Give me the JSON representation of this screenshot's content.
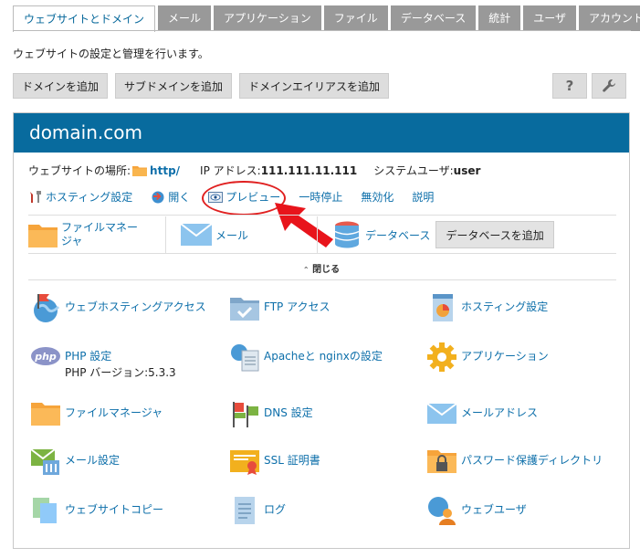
{
  "tabs": [
    "ウェブサイトとドメイン",
    "メール",
    "アプリケーション",
    "ファイル",
    "データベース",
    "統計",
    "ユーザ",
    "アカウント"
  ],
  "description": "ウェブサイトの設定と管理を行います。",
  "toolbar": {
    "add_domain": "ドメインを追加",
    "add_subdomain": "サブドメインを追加",
    "add_alias": "ドメインエイリアスを追加",
    "help": "?"
  },
  "domain": {
    "name": "domain.com",
    "location_label": "ウェブサイトの場所:",
    "location_value": "http/",
    "ip_label": "IP アドレス:",
    "ip_value": "111.111.11.111",
    "sysuser_label": "システムユーザ:",
    "sysuser_value": "user"
  },
  "actions": [
    "ホスティング設定",
    "開く",
    "プレビュー",
    "一時停止",
    "無効化",
    "説明"
  ],
  "quick": {
    "file_manager": "ファイルマネージャ",
    "mail": "メール",
    "database": "データベース",
    "add_database": "データベースを追加"
  },
  "close_label": "閉じる",
  "grid": [
    {
      "label": "ウェブホスティングアクセス",
      "icon": "globe-flag-icon"
    },
    {
      "label": "FTP アクセス",
      "icon": "ftp-folder-icon"
    },
    {
      "label": "ホスティング設定",
      "icon": "hosting-settings-icon"
    },
    {
      "label": "PHP 設定",
      "sub": "PHP バージョン:5.3.3",
      "icon": "php-icon"
    },
    {
      "label": "Apacheと nginxの設定",
      "icon": "apache-nginx-icon"
    },
    {
      "label": "アプリケーション",
      "icon": "gear-icon"
    },
    {
      "label": "ファイルマネージャ",
      "icon": "folder-icon"
    },
    {
      "label": "DNS 設定",
      "icon": "dns-icon"
    },
    {
      "label": "メールアドレス",
      "icon": "envelope-icon"
    },
    {
      "label": "メール設定",
      "icon": "mail-settings-icon"
    },
    {
      "label": "SSL 証明書",
      "icon": "certificate-icon"
    },
    {
      "label": "パスワード保護ディレクトリ",
      "icon": "lock-folder-icon"
    },
    {
      "label": "ウェブサイトコピー",
      "icon": "copy-icon"
    },
    {
      "label": "ログ",
      "icon": "log-icon"
    },
    {
      "label": "ウェブユーザ",
      "icon": "web-user-icon"
    }
  ],
  "colors": {
    "header": "#086b9e",
    "link": "#0d6faa",
    "tab_inactive": "#999999",
    "highlight": "#e02020"
  }
}
